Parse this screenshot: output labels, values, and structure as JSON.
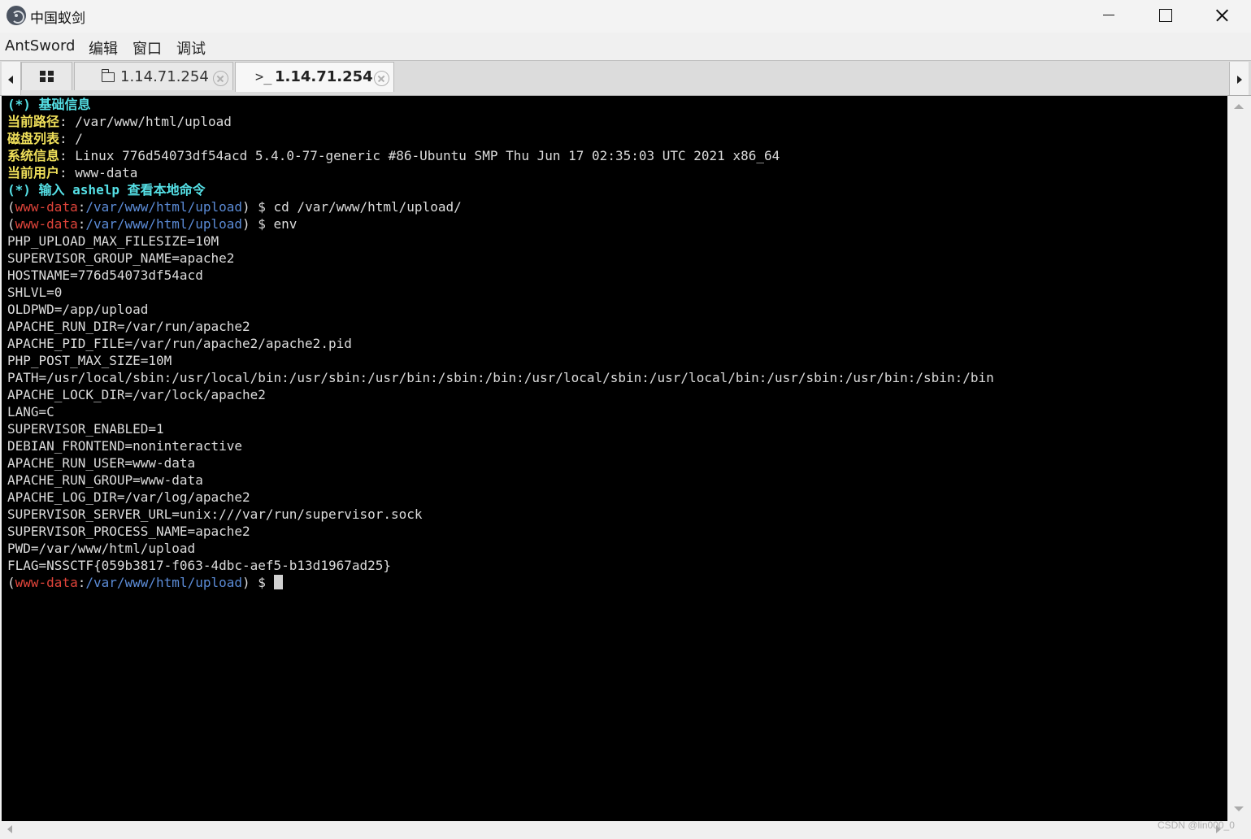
{
  "window": {
    "title": "中国蚁剑",
    "icon": "antsword-logo-icon",
    "controls": [
      "minimize-icon",
      "maximize-icon",
      "close-icon"
    ]
  },
  "menu": [
    "AntSword",
    "编辑",
    "窗口",
    "调试"
  ],
  "tabs": [
    {
      "icon": "grid-icon",
      "label": ""
    },
    {
      "icon": "folder-icon",
      "label": "1.14.71.254"
    },
    {
      "icon": "terminal-icon",
      "glyph": ">_",
      "label": "1.14.71.254",
      "active": true
    }
  ],
  "terminal": {
    "lines": [
      [
        {
          "t": "(*) 基础信息",
          "c": "head"
        }
      ],
      [
        {
          "t": "当前路径",
          "c": "label"
        },
        {
          "t": ": /var/www/html/upload",
          "c": "plain"
        }
      ],
      [
        {
          "t": "磁盘列表",
          "c": "label"
        },
        {
          "t": ": /",
          "c": "plain"
        }
      ],
      [
        {
          "t": "系统信息",
          "c": "label"
        },
        {
          "t": ": Linux 776d54073df54acd 5.4.0-77-generic #86-Ubuntu SMP Thu Jun 17 02:35:03 UTC 2021 x86_64",
          "c": "plain"
        }
      ],
      [
        {
          "t": "当前用户",
          "c": "label"
        },
        {
          "t": ": www-data",
          "c": "plain"
        }
      ],
      [
        {
          "t": "(*) 输入 ashelp 查看本地命令",
          "c": "head"
        }
      ],
      [
        {
          "t": "(",
          "c": "plain"
        },
        {
          "t": "www-data",
          "c": "user"
        },
        {
          "t": ":",
          "c": "plain"
        },
        {
          "t": "/var/www/html/upload",
          "c": "path"
        },
        {
          "t": ") $ cd /var/www/html/upload/",
          "c": "plain"
        }
      ],
      [
        {
          "t": "(",
          "c": "plain"
        },
        {
          "t": "www-data",
          "c": "user"
        },
        {
          "t": ":",
          "c": "plain"
        },
        {
          "t": "/var/www/html/upload",
          "c": "path"
        },
        {
          "t": ") $ env",
          "c": "plain"
        }
      ],
      [
        {
          "t": "PHP_UPLOAD_MAX_FILESIZE=10M",
          "c": "plain"
        }
      ],
      [
        {
          "t": "SUPERVISOR_GROUP_NAME=apache2",
          "c": "plain"
        }
      ],
      [
        {
          "t": "HOSTNAME=776d54073df54acd",
          "c": "plain"
        }
      ],
      [
        {
          "t": "SHLVL=0",
          "c": "plain"
        }
      ],
      [
        {
          "t": "OLDPWD=/app/upload",
          "c": "plain"
        }
      ],
      [
        {
          "t": "APACHE_RUN_DIR=/var/run/apache2",
          "c": "plain"
        }
      ],
      [
        {
          "t": "APACHE_PID_FILE=/var/run/apache2/apache2.pid",
          "c": "plain"
        }
      ],
      [
        {
          "t": "PHP_POST_MAX_SIZE=10M",
          "c": "plain"
        }
      ],
      [
        {
          "t": "PATH=/usr/local/sbin:/usr/local/bin:/usr/sbin:/usr/bin:/sbin:/bin:/usr/local/sbin:/usr/local/bin:/usr/sbin:/usr/bin:/sbin:/bin",
          "c": "plain"
        }
      ],
      [
        {
          "t": "APACHE_LOCK_DIR=/var/lock/apache2",
          "c": "plain"
        }
      ],
      [
        {
          "t": "LANG=C",
          "c": "plain"
        }
      ],
      [
        {
          "t": "SUPERVISOR_ENABLED=1",
          "c": "plain"
        }
      ],
      [
        {
          "t": "DEBIAN_FRONTEND=noninteractive",
          "c": "plain"
        }
      ],
      [
        {
          "t": "APACHE_RUN_USER=www-data",
          "c": "plain"
        }
      ],
      [
        {
          "t": "APACHE_RUN_GROUP=www-data",
          "c": "plain"
        }
      ],
      [
        {
          "t": "APACHE_LOG_DIR=/var/log/apache2",
          "c": "plain"
        }
      ],
      [
        {
          "t": "SUPERVISOR_SERVER_URL=unix:///var/run/supervisor.sock",
          "c": "plain"
        }
      ],
      [
        {
          "t": "SUPERVISOR_PROCESS_NAME=apache2",
          "c": "plain"
        }
      ],
      [
        {
          "t": "PWD=/var/www/html/upload",
          "c": "plain"
        }
      ],
      [
        {
          "t": "FLAG=NSSCTF{059b3817-f063-4dbc-aef5-b13d1967ad25}",
          "c": "plain"
        }
      ],
      [
        {
          "t": "(",
          "c": "plain"
        },
        {
          "t": "www-data",
          "c": "user"
        },
        {
          "t": ":",
          "c": "plain"
        },
        {
          "t": "/var/www/html/upload",
          "c": "path"
        },
        {
          "t": ") $ ",
          "c": "plain"
        },
        {
          "cursor": true
        }
      ]
    ]
  },
  "colors": {
    "terminal_bg": "#000000",
    "heading": "#55e0e6",
    "label": "#f0e05a",
    "prompt_user": "#e0443a",
    "prompt_path": "#5b8bd6",
    "text": "#dcdcdc"
  },
  "watermark": "CSDN @lin000_0"
}
